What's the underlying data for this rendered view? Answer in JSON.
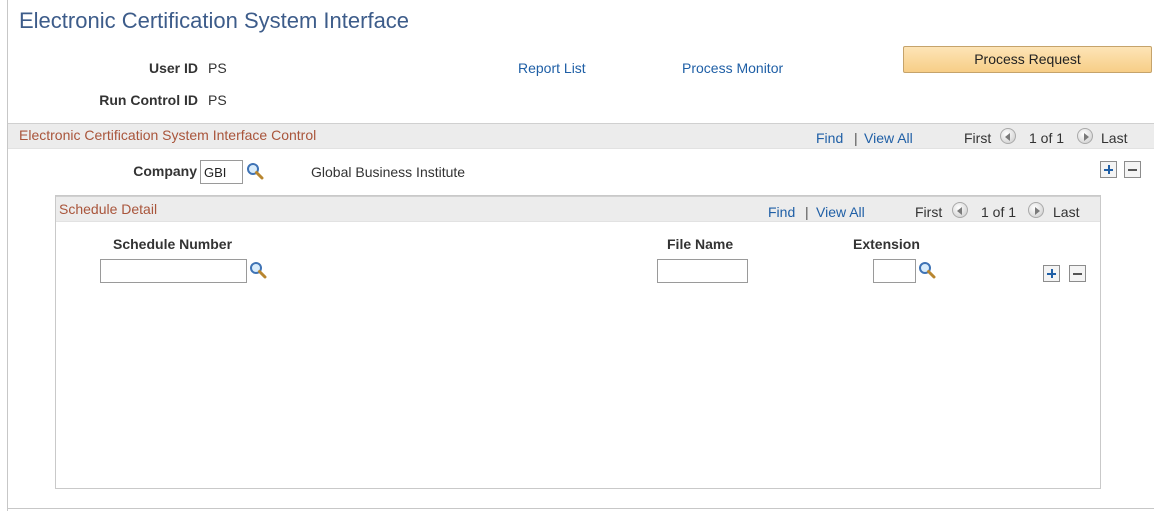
{
  "page": {
    "title": "Electronic Certification System Interface"
  },
  "run_info": {
    "user_id_label": "User ID",
    "user_id_value": "PS",
    "run_control_label": "Run Control ID",
    "run_control_value": "PS"
  },
  "links": {
    "report_list": "Report List",
    "process_monitor": "Process Monitor"
  },
  "process_request_label": "Process Request",
  "control_grid": {
    "title": "Electronic Certification System Interface Control",
    "find": "Find",
    "separator": "|",
    "view_all": "View All",
    "first": "First",
    "position": "1 of 1",
    "last": "Last",
    "company_label": "Company",
    "company_value": "GBI",
    "company_desc": "Global Business Institute"
  },
  "schedule_grid": {
    "title": "Schedule Detail",
    "find": "Find",
    "separator": "|",
    "view_all": "View All",
    "first": "First",
    "position": "1 of 1",
    "last": "Last",
    "columns": {
      "schedule_number": "Schedule Number",
      "file_name": "File Name",
      "extension": "Extension"
    },
    "row": {
      "schedule_number": "",
      "file_name": "",
      "extension": ""
    }
  },
  "icons": {
    "lookup": "magnifier-lookup-icon",
    "prev": "previous-arrow-icon",
    "next": "next-arrow-icon",
    "add_row": "plus-icon",
    "delete_row": "minus-icon"
  },
  "colors": {
    "title": "#3d5c8a",
    "link": "#1f5fa6",
    "grid_title": "#a9553b",
    "button_bg": "#f7ce87"
  }
}
